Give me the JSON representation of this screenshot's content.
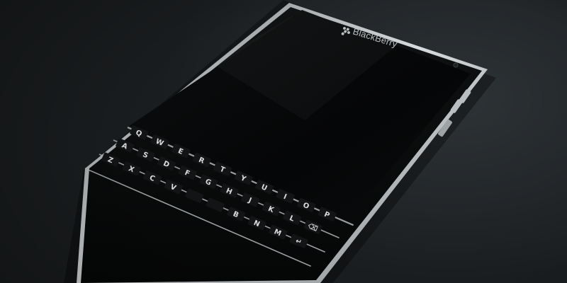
{
  "device": {
    "brand": "BlackBerry",
    "colors": {
      "frame": "#c9cdd0",
      "screen": "#07090a",
      "body": "#0d0f10",
      "key": "#121415",
      "fret": "#aeb3b6"
    },
    "keyboard": {
      "rows": [
        [
          "Q",
          "W",
          "E",
          "R",
          "T",
          "Y",
          "U",
          "I",
          "O",
          "P"
        ],
        [
          "A",
          "S",
          "D",
          "F",
          "G",
          "H",
          "J",
          "K",
          "L",
          "⌫"
        ],
        [
          "Z",
          "X",
          "C",
          "V",
          "",
          "",
          "B",
          "N",
          "M",
          "↵"
        ]
      ]
    }
  }
}
